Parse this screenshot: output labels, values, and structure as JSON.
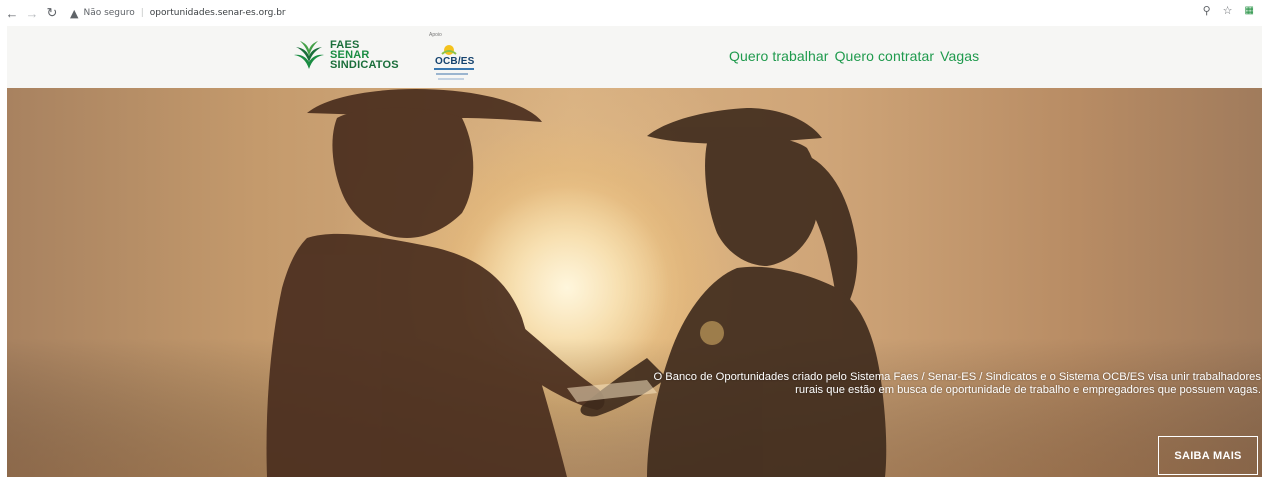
{
  "browser": {
    "security_label": "Não seguro",
    "url": "oportunidades.senar-es.org.br",
    "icons": [
      "back-arrow-icon",
      "forward-arrow-icon",
      "reload-icon",
      "warning-icon",
      "zoom-icon",
      "star-icon",
      "extension-icon"
    ]
  },
  "header": {
    "logo_faes": {
      "line1": "FAES",
      "line2": "SENAR",
      "line3": "SINDICATOS"
    },
    "logo_ocb": {
      "apoio": "Apoio",
      "name": "OCB/ES"
    },
    "nav": [
      {
        "label": "Quero trabalhar"
      },
      {
        "label": "Quero contratar"
      },
      {
        "label": "Vagas"
      }
    ],
    "nav_color": "#1f9a4d"
  },
  "hero": {
    "description": "O Banco de Oportunidades criado pelo Sistema Faes / Senar-ES / Sindicatos e o Sistema OCB/ES visa unir trabalhadores rurais que estão em busca de oportunidade de trabalho e empregadores que possuem vagas.",
    "cta_label": "SAIBA MAIS"
  }
}
